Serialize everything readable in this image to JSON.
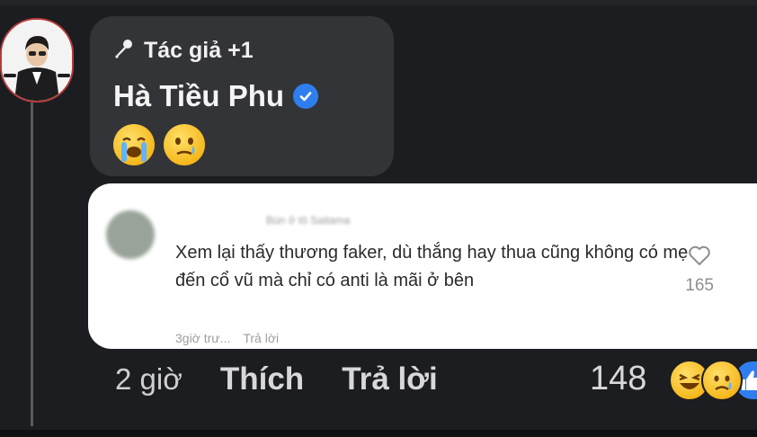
{
  "author_bubble": {
    "badge_icon": "microphone-icon",
    "badge_label": "Tác giả +1",
    "name": "Hà Tiều Phu",
    "verified_icon": "verified-check-icon",
    "emojis": [
      "loudly-crying-face",
      "face-holding-back-tears"
    ]
  },
  "quoted_comment": {
    "author": "Bún ở tô Saitama",
    "text": "Xem lại thấy thương faker, dù thắng hay thua cũng không có mẹ đến cổ vũ mà chỉ có anti là mãi ở bên",
    "time": "3giờ trư...",
    "reply_label": "Trả lời",
    "like_icon": "heart-outline-icon",
    "like_count": "165"
  },
  "actions": {
    "time": "2 giờ",
    "like_label": "Thích",
    "reply_label": "Trả lời",
    "reaction_count": "148",
    "reactions": [
      "haha-icon",
      "sad-icon",
      "like-icon"
    ]
  },
  "colors": {
    "background": "#1c1d20",
    "bubble": "#333437",
    "verified": "#2f7ef0",
    "card": "#ffffff"
  }
}
